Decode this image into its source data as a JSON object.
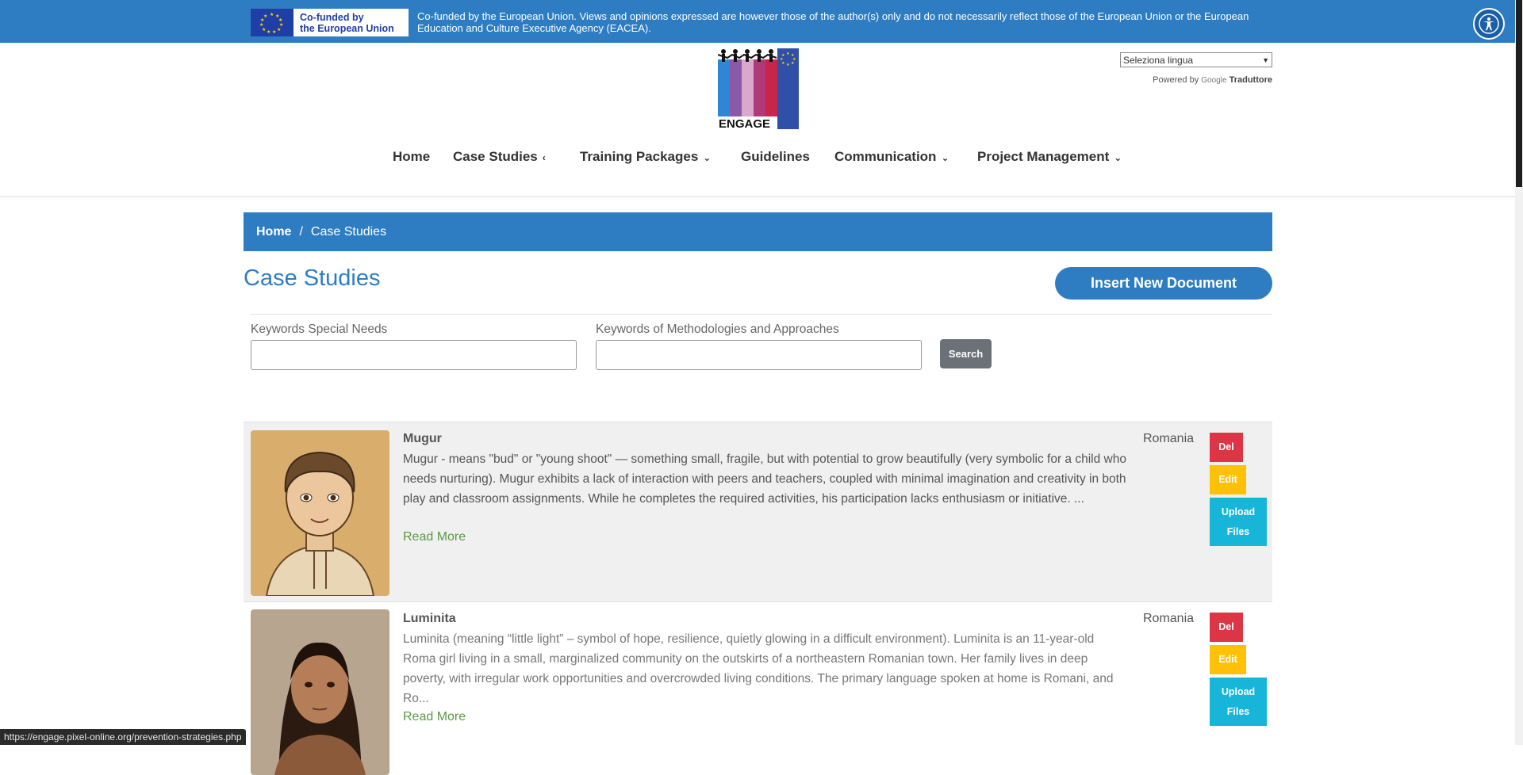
{
  "top_banner": {
    "eu_logo_line1": "Co-funded by",
    "eu_logo_line2": "the European Union",
    "disclaimer": "Co-funded by the European Union. Views and opinions expressed are however those of the author(s) only and do not necessarily reflect those of the European Union or the European Education and Culture Executive Agency (EACEA).",
    "accessibility_icon": "accessibility-icon"
  },
  "logo": {
    "text": "ENGAGE"
  },
  "translate": {
    "select_value": "Seleziona lingua",
    "powered_by": "Powered by",
    "google": "Google",
    "translator": "Traduttore"
  },
  "nav": {
    "items": [
      {
        "label": "Home",
        "has_dropdown": false
      },
      {
        "label": "Case Studies",
        "chevron": "‹"
      },
      {
        "label": "Training Packages",
        "chevron": "⌄"
      },
      {
        "label": "Guidelines",
        "has_dropdown": false
      },
      {
        "label": "Communication",
        "chevron": "⌄"
      },
      {
        "label": "Project Management",
        "chevron": "⌄"
      }
    ]
  },
  "breadcrumb": {
    "home": "Home",
    "separator": "/",
    "current": "Case Studies"
  },
  "page": {
    "title": "Case Studies",
    "insert_button": "Insert New Document"
  },
  "filters": {
    "special_needs_label": "Keywords Special Needs",
    "special_needs_value": "",
    "methodologies_label": "Keywords of Methodologies and Approaches",
    "methodologies_value": "",
    "search_button": "Search"
  },
  "cases": [
    {
      "title": "Mugur",
      "description": "Mugur - means \"bud\" or \"young shoot\" — something small, fragile, but with potential to grow beautifully (very symbolic for a child who needs nurturing). Mugur exhibits a lack of interaction with peers and teachers, coupled with minimal imagination and creativity in both play and classroom assignments. While he completes the required activities, his participation lacks enthusiasm or initiative. ...",
      "read_more": "Read More",
      "country": "Romania",
      "del": "Del",
      "edit": "Edit",
      "upload_line1": "Upload",
      "upload_line2": "Files"
    },
    {
      "title": "Luminita",
      "description": "Luminita (meaning “little light” – symbol of hope, resilience, quietly glowing in a difficult environment). Luminita is an 11-year-old Roma girl living in a small, marginalized community on the outskirts of a northeastern Romanian town. Her family lives in deep poverty, with irregular work opportunities and overcrowded living conditions. The primary language spoken at home is Romani, and Ro...",
      "read_more": "Read More",
      "country": "Romania",
      "del": "Del",
      "edit": "Edit",
      "upload_line1": "Upload",
      "upload_line2": "Files"
    }
  ],
  "status_bar": {
    "url": "https://engage.pixel-online.org/prevention-strategies.php"
  },
  "colors": {
    "primary_blue": "#2e7dc3",
    "delete_red": "#dc3545",
    "edit_yellow": "#ffc107",
    "upload_cyan": "#17b5d8",
    "read_more_green": "#5b9a43"
  }
}
